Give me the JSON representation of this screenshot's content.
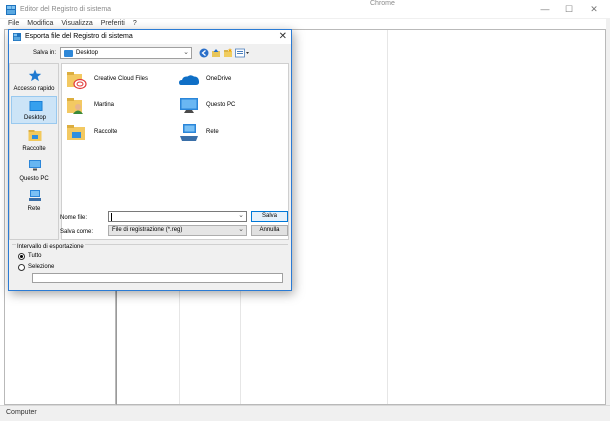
{
  "window": {
    "title": "Editor del Registro di sistema",
    "center_title": "Chrome",
    "controls": {
      "minimize": "—",
      "maximize": "☐",
      "close": "✕"
    }
  },
  "menu": [
    "File",
    "Modifica",
    "Visualizza",
    "Preferiti",
    "?"
  ],
  "statusbar": {
    "text": "Computer"
  },
  "dialog": {
    "title": "Esporta file del Registro di sistema",
    "close": "✕",
    "save_in_label": "Salva in:",
    "save_in_value": "Desktop",
    "places": [
      {
        "label": "Accesso rapido",
        "icon": "star-icon"
      },
      {
        "label": "Desktop",
        "icon": "desktop-icon",
        "selected": true
      },
      {
        "label": "Raccolte",
        "icon": "libraries-icon"
      },
      {
        "label": "Questo PC",
        "icon": "computer-icon"
      },
      {
        "label": "Rete",
        "icon": "network-icon"
      }
    ],
    "files": [
      {
        "label": "Creative Cloud Files",
        "icon": "creative-cloud-folder-icon"
      },
      {
        "label": "OneDrive",
        "icon": "onedrive-icon"
      },
      {
        "label": "Martina",
        "icon": "user-folder-icon"
      },
      {
        "label": "Questo PC",
        "icon": "computer-icon"
      },
      {
        "label": "Raccolte",
        "icon": "libraries-icon"
      },
      {
        "label": "Rete",
        "icon": "network-icon"
      }
    ],
    "file_name_label": "Nome file:",
    "file_name_value": "",
    "save_as_label": "Salva come:",
    "save_as_value": "File di registrazione (*.reg)",
    "save_button": "Salva",
    "cancel_button": "Annulla",
    "export_range": {
      "legend": "Intervallo di esportazione",
      "all_label": "Tutto",
      "all_checked": true,
      "selection_label": "Selezione",
      "selection_checked": false
    }
  }
}
